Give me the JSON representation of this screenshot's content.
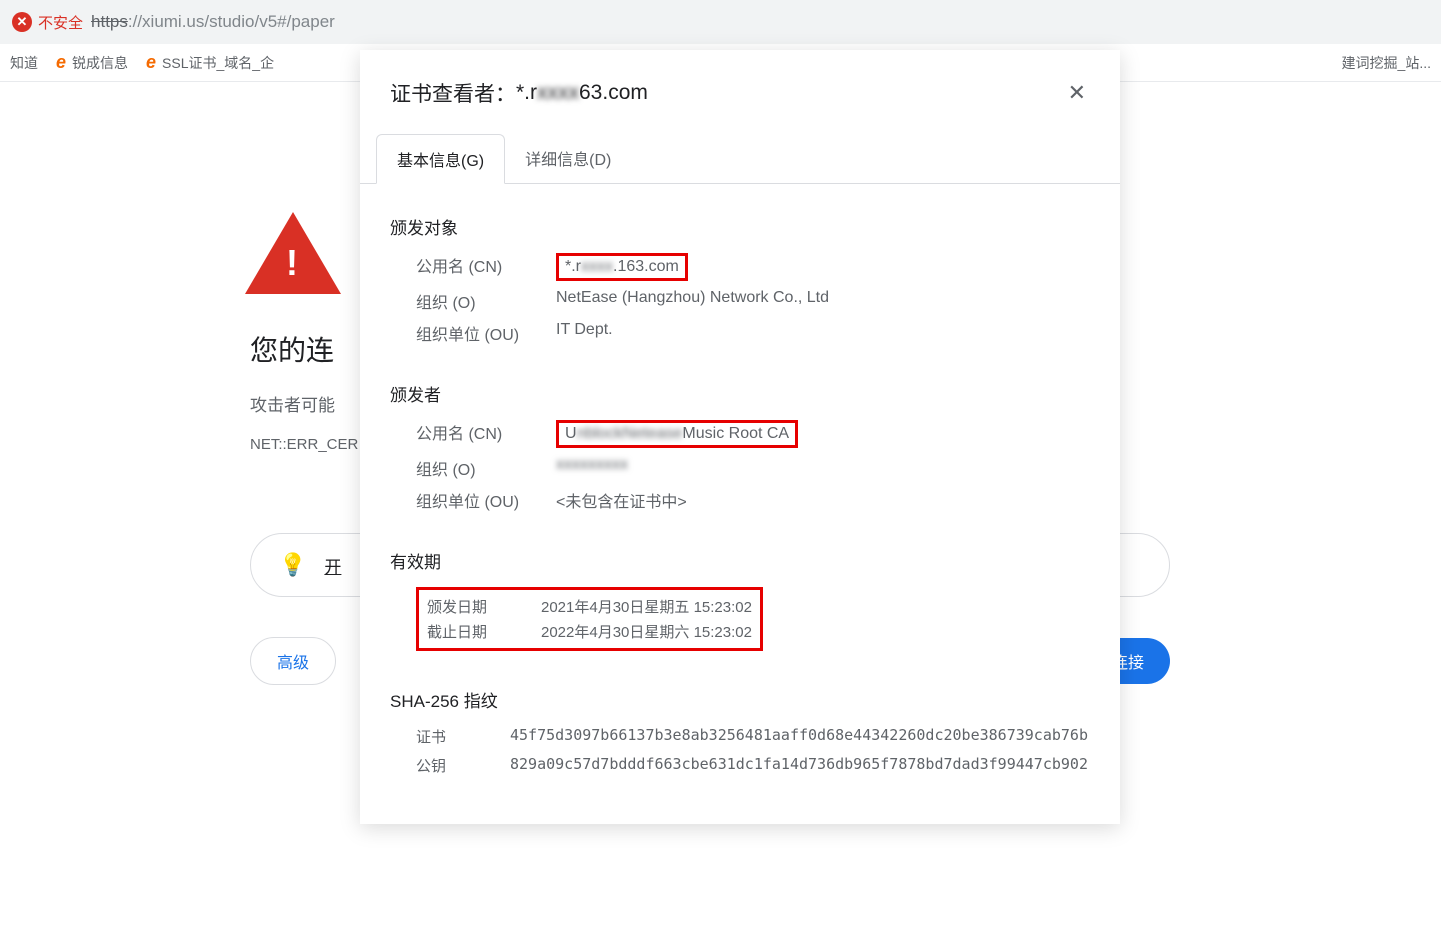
{
  "address_bar": {
    "security_label": "不安全",
    "url_protocol": "https",
    "url_rest": "://xiumi.us/studio/v5#/paper"
  },
  "bookmarks": [
    {
      "icon": "",
      "label": "知道"
    },
    {
      "icon": "e",
      "label": "锐成信息"
    },
    {
      "icon": "e",
      "label": "SSL证书_域名_企"
    },
    {
      "icon": "",
      "label": "建词挖掘_站..."
    }
  ],
  "error_page": {
    "heading": "您的连",
    "subtext": "攻击者可能",
    "code": "NET::ERR_CER",
    "protection": "开",
    "advanced_btn": "高级",
    "safety_btn": "安全连接"
  },
  "cert_modal": {
    "title_prefix": "证书查看者：",
    "title_domain_start": "*.r",
    "title_domain_blur": "xxxx",
    "title_domain_end": "63.com",
    "tabs": [
      "基本信息(G)",
      "详细信息(D)"
    ],
    "subject": {
      "title": "颁发对象",
      "cn_label": "公用名 (CN)",
      "cn_value_start": "*.r",
      "cn_value_blur": "xxxx",
      "cn_value_end": ".163.com",
      "o_label": "组织 (O)",
      "o_value": "NetEase (Hangzhou) Network Co., Ltd",
      "ou_label": "组织单位 (OU)",
      "ou_value": "IT Dept."
    },
    "issuer": {
      "title": "颁发者",
      "cn_label": "公用名 (CN)",
      "cn_value_start": "U",
      "cn_value_blur": "nblockNetease",
      "cn_value_end": "Music Root CA",
      "o_label": "组织 (O)",
      "o_value_blur": "xxxxxxxxx",
      "ou_label": "组织单位 (OU)",
      "ou_value": "<未包含在证书中>"
    },
    "validity": {
      "title": "有效期",
      "issued_label": "颁发日期",
      "issued_value": "2021年4月30日星期五 15:23:02",
      "expires_label": "截止日期",
      "expires_value": "2022年4月30日星期六 15:23:02"
    },
    "fingerprint": {
      "title": "SHA-256 指纹",
      "cert_label": "证书",
      "cert_value": "45f75d3097b66137b3e8ab3256481aaff0d68e44342260dc20be386739cab76b",
      "pubkey_label": "公钥",
      "pubkey_value": "829a09c57d7bdddf663cbe631dc1fa14d736db965f7878bd7dad3f99447cb902"
    }
  }
}
